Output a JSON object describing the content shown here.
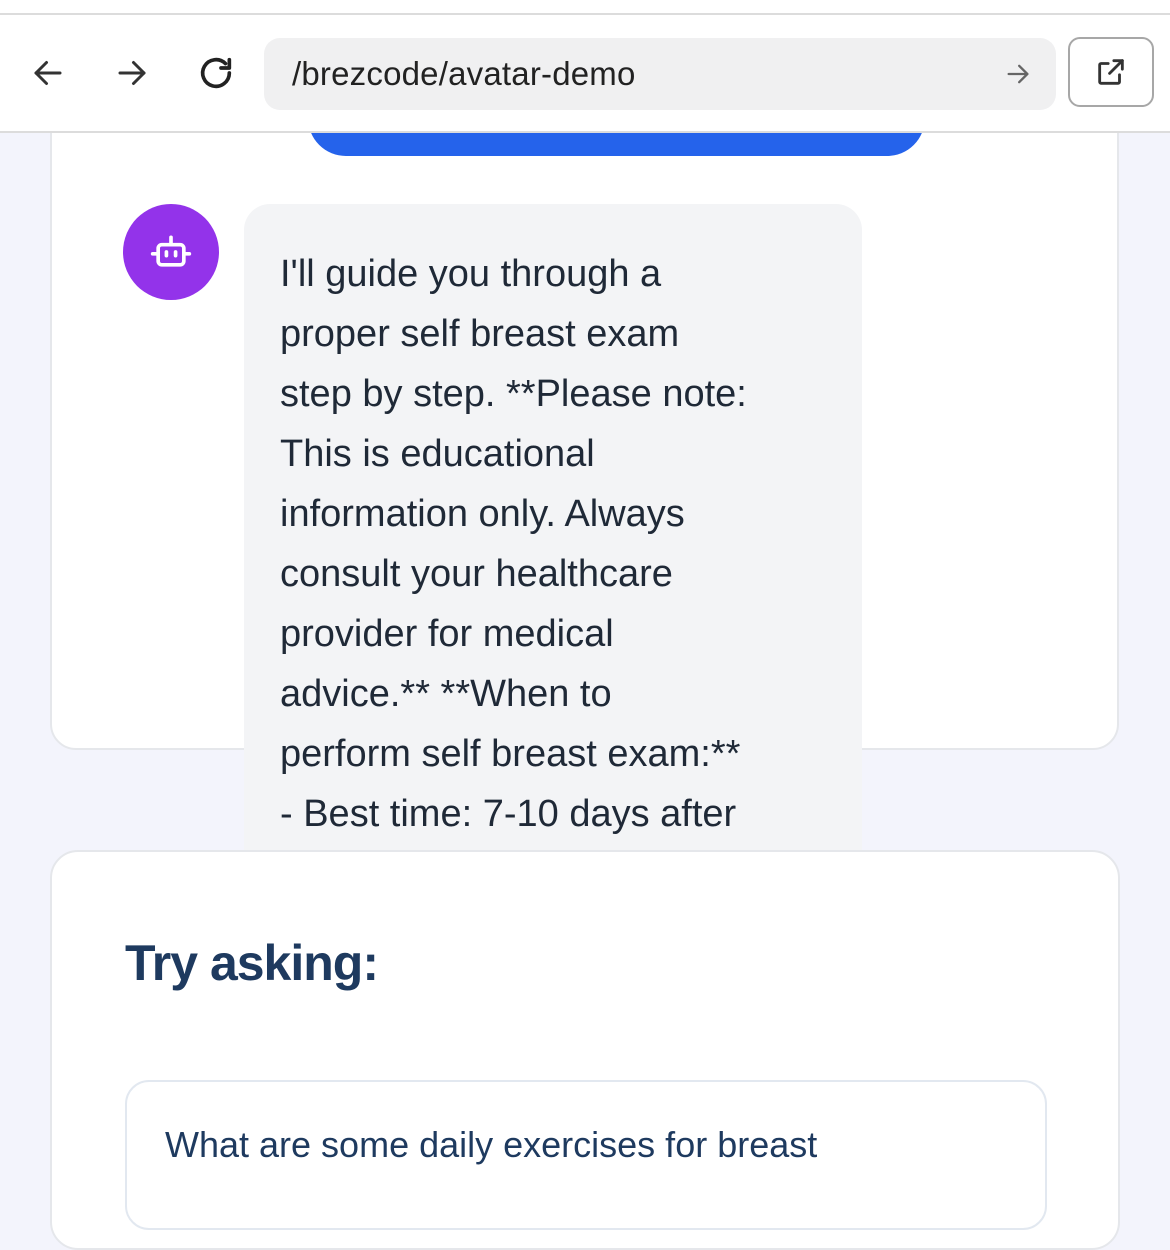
{
  "browser": {
    "url": "/brezcode/avatar-demo",
    "back_icon": "arrow-left-icon",
    "forward_icon": "arrow-right-icon",
    "reload_icon": "reload-icon",
    "go_icon": "arrow-right-icon",
    "open_external_icon": "external-link-icon"
  },
  "chat": {
    "assistant_avatar_icon": "bot-icon",
    "assistant_message": "I'll guide you through a\nproper self breast exam\nstep by step. **Please note:\nThis is educational\ninformation only. Always\nconsult your healthcare\nprovider for medical\nadvice.** **When to\nperform self breast exam:**\n- Best time: 7-10 days after"
  },
  "suggestions": {
    "title": "Try asking:",
    "items": [
      "What are some daily exercises for breast"
    ]
  },
  "colors": {
    "accent_blue": "#2563eb",
    "avatar_purple": "#9333ea",
    "heading": "#1e3a5f",
    "page_bg": "#f3f4fc",
    "bubble_bg": "#f3f4f6"
  }
}
